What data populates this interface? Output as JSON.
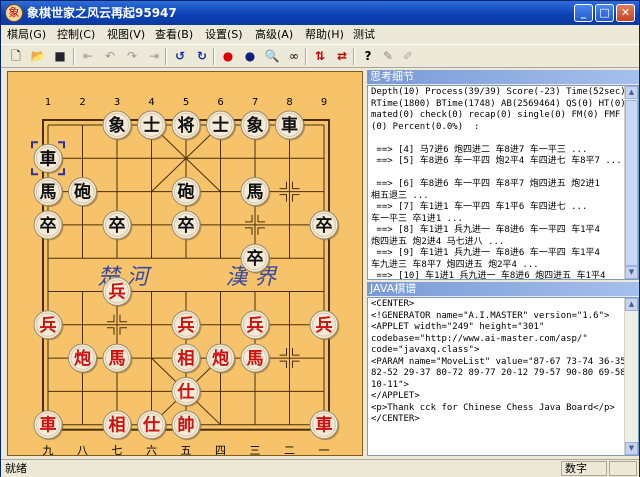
{
  "window": {
    "title": "象棋世家之风云再起95947"
  },
  "titlebar": {
    "minimize": "_",
    "maximize": "□",
    "close": "✕"
  },
  "menu": [
    "棋局(G)",
    "控制(C)",
    "视图(V)",
    "查看(B)",
    "设置(S)",
    "高级(A)",
    "帮助(H)",
    "测试"
  ],
  "toolbar": {
    "icons": [
      "new-icon",
      "open-icon",
      "save-icon",
      "first-move-icon",
      "prev-move-icon",
      "next-move-icon",
      "last-move-icon",
      "undo-icon",
      "redo-icon",
      "red-piece-icon",
      "black-piece-icon",
      "search-icon",
      "glasses-icon",
      "swap-icon",
      "flip-icon",
      "help-icon",
      "pen-icon",
      "pen-gray-icon"
    ]
  },
  "board": {
    "top_numbers": [
      "1",
      "2",
      "3",
      "4",
      "5",
      "6",
      "7",
      "8",
      "9"
    ],
    "bottom_numbers": [
      "九",
      "八",
      "七",
      "六",
      "五",
      "四",
      "三",
      "二",
      "一"
    ],
    "river_left": "楚 河",
    "river_right": "漢 界",
    "black_pieces": [
      {
        "label": "象",
        "col": 2,
        "row": 0
      },
      {
        "label": "士",
        "col": 3,
        "row": 0
      },
      {
        "label": "将",
        "col": 4,
        "row": 0
      },
      {
        "label": "士",
        "col": 5,
        "row": 0
      },
      {
        "label": "象",
        "col": 6,
        "row": 0
      },
      {
        "label": "車",
        "col": 7,
        "row": 0
      },
      {
        "label": "車",
        "col": 0,
        "row": 1
      },
      {
        "label": "馬",
        "col": 0,
        "row": 2
      },
      {
        "label": "砲",
        "col": 1,
        "row": 2
      },
      {
        "label": "砲",
        "col": 4,
        "row": 2
      },
      {
        "label": "馬",
        "col": 6,
        "row": 2
      },
      {
        "label": "卒",
        "col": 0,
        "row": 3
      },
      {
        "label": "卒",
        "col": 2,
        "row": 3
      },
      {
        "label": "卒",
        "col": 4,
        "row": 3
      },
      {
        "label": "卒",
        "col": 8,
        "row": 3
      },
      {
        "label": "卒",
        "col": 6,
        "row": 4
      }
    ],
    "red_pieces": [
      {
        "label": "兵",
        "col": 2,
        "row": 5
      },
      {
        "label": "兵",
        "col": 0,
        "row": 6
      },
      {
        "label": "兵",
        "col": 4,
        "row": 6
      },
      {
        "label": "兵",
        "col": 6,
        "row": 6
      },
      {
        "label": "兵",
        "col": 8,
        "row": 6
      },
      {
        "label": "炮",
        "col": 1,
        "row": 7
      },
      {
        "label": "馬",
        "col": 2,
        "row": 7
      },
      {
        "label": "相",
        "col": 4,
        "row": 7
      },
      {
        "label": "炮",
        "col": 5,
        "row": 7
      },
      {
        "label": "馬",
        "col": 6,
        "row": 7
      },
      {
        "label": "仕",
        "col": 4,
        "row": 8
      },
      {
        "label": "車",
        "col": 0,
        "row": 9
      },
      {
        "label": "相",
        "col": 2,
        "row": 9
      },
      {
        "label": "仕",
        "col": 3,
        "row": 9
      },
      {
        "label": "帥",
        "col": 4,
        "row": 9
      },
      {
        "label": "車",
        "col": 8,
        "row": 9
      }
    ],
    "selected": {
      "col": 0,
      "row": 1
    }
  },
  "thinking_panel": {
    "title": "思考细节",
    "text": "Depth(10) Process(39/39) Score(-23) Time(52sec)\nRTime(1800) BTime(1748) AB(2569464) QS(0) HT(0)\nmated(0) check(0) recap(0) single(0) FM(0) FMF\n(0) Percent(0.0%)  :\n\n ==> [4] 马7进6 炮四进二 车8进7 车一平三 ...\n ==> [5] 车8进6 车一平四 炮2平4 车四进七 车8平7 ...\n\n ==> [6] 车8进6 车一平四 车8平7 炮四进五 炮2进1\n相五退三 ...\n ==> [7] 车1进1 车一平四 车1平6 车四进七 ...\n车一平三 卒1进1 ...\n ==> [8] 车1进1 兵九进一 车8进6 车一平四 车1平4\n炮四进五 炮2进4 马七进八 ...\n ==> [9] 车1进1 兵九进一 车8进6 车一平四 车1平4\n车九进三 车8平7 炮四进五 炮2平4 ...\n ==> [10] 车1进1 兵九进一 车8进6 炮四进五 车1平4"
  },
  "java_panel": {
    "title": "JAVA棋谱",
    "text": "<CENTER>\n<!GENERATOR name=\"A.I.MASTER\" version=\"1.6\">\n<APPLET width=\"249\" height=\"301\"\ncodebase=\"http://www.ai-master.com/asp/\"\ncode=\"javaxq.class\">\n<PARAM name=\"MoveList\" value=\"87-67 73-74 36-35\n82-52 29-37 80-72 89-77 20-12 79-57 90-80 69-58\n10-11\">\n</APPLET>\n<p>Thank cck for Chinese Chess Java Board</p>\n</CENTER>"
  },
  "status": {
    "text": "就绪",
    "mode": "数字"
  }
}
